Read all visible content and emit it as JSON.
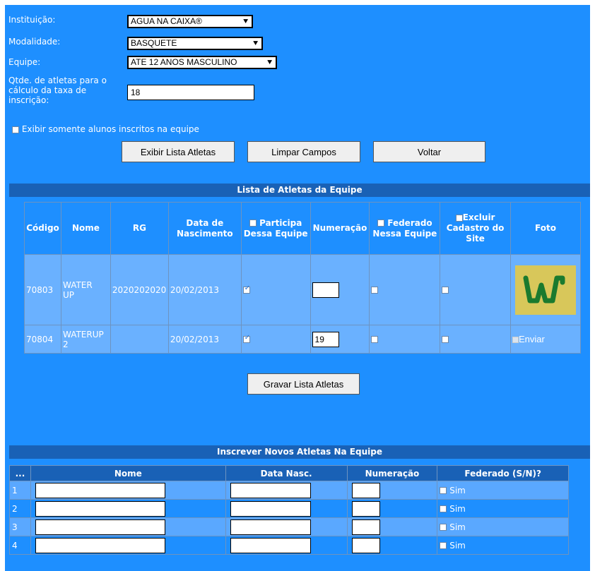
{
  "form": {
    "instituicao_label": "Instituição:",
    "instituicao_value": "AGUA NA CAIXA®",
    "modalidade_label": "Modalidade:",
    "modalidade_value": "BASQUETE",
    "equipe_label": "Equipe:",
    "equipe_value": "ATE 12 ANOS MASCULINO",
    "qtde_label_1": "Qtde. de atletas para o",
    "qtde_label_2": "cálculo da taxa de",
    "qtde_label_3": "inscrição:",
    "qtde_value": "18",
    "exibir_somente_label": "Exibir somente alunos inscritos na equipe"
  },
  "buttons": {
    "exibir": "Exibir Lista Atletas",
    "limpar": "Limpar Campos",
    "voltar": "Voltar",
    "gravar": "Gravar Lista Atletas"
  },
  "team_list": {
    "title": "Lista de Atletas da Equipe",
    "headers": {
      "codigo": "Código",
      "nome": "Nome",
      "rg": "RG",
      "data_1": "Data de",
      "data_2": "Nascimento",
      "participa_1": "Participa",
      "participa_2": "Dessa Equipe",
      "numeracao": "Numeração",
      "federado_1": "Federado",
      "federado_2": "Nessa Equipe",
      "excluir_1": "Excluir",
      "excluir_2": "Cadastro do",
      "excluir_3": "Site",
      "foto": "Foto"
    },
    "rows": [
      {
        "codigo": "70803",
        "nome_1": "WATER",
        "nome_2": "UP",
        "rg": "2020202020",
        "data": "20/02/2013",
        "participa": true,
        "numeracao": "",
        "federado": false,
        "excluir": false,
        "foto": "logo"
      },
      {
        "codigo": "70804",
        "nome_1": "WATERUP",
        "nome_2": "2",
        "rg": "",
        "data": "20/02/2013",
        "participa": true,
        "numeracao": "19",
        "federado": false,
        "excluir": false,
        "foto_alt": "Enviar"
      }
    ]
  },
  "new_athletes": {
    "title": "Inscrever Novos Atletas Na Equipe",
    "headers": {
      "idx": "...",
      "nome": "Nome",
      "data": "Data Nasc.",
      "numeracao": "Numeração",
      "federado": "Federado (S/N)?"
    },
    "rows": [
      {
        "idx": "1",
        "sim": "Sim"
      },
      {
        "idx": "2",
        "sim": "Sim"
      },
      {
        "idx": "3",
        "sim": "Sim"
      },
      {
        "idx": "4",
        "sim": "Sim"
      }
    ]
  },
  "colors": {
    "background": "#1e8fff",
    "row_light": "#6ab1ff",
    "header_dark": "#1961b6",
    "logo_bg": "#d8c75a",
    "logo_fg": "#1b7a2e"
  }
}
